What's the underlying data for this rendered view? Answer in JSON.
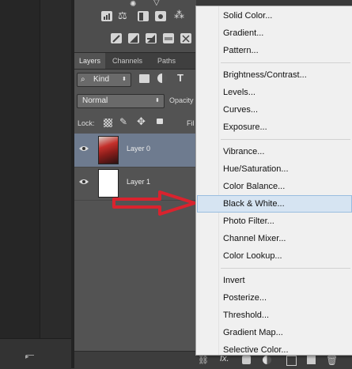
{
  "panel_tabs": [
    "Layers",
    "Channels",
    "Paths"
  ],
  "filter": {
    "kind_label": "Kind"
  },
  "blend": {
    "mode": "Normal",
    "opacity_label": "Opacity"
  },
  "lock": {
    "label": "Lock:",
    "fill_label": "Fil"
  },
  "layers": [
    {
      "name": "Layer 0",
      "selected": true
    },
    {
      "name": "Layer 1",
      "selected": false
    }
  ],
  "bottom_bar": {
    "fx_label": "fx."
  },
  "menu": {
    "groups": [
      [
        "Solid Color...",
        "Gradient...",
        "Pattern..."
      ],
      [
        "Brightness/Contrast...",
        "Levels...",
        "Curves...",
        "Exposure..."
      ],
      [
        "Vibrance...",
        "Hue/Saturation...",
        "Color Balance...",
        "Black & White...",
        "Photo Filter...",
        "Channel Mixer...",
        "Color Lookup..."
      ],
      [
        "Invert",
        "Posterize...",
        "Threshold...",
        "Gradient Map...",
        "Selective Color..."
      ]
    ],
    "highlighted": "Black & White..."
  },
  "colors": {
    "arrow": "#d9232e",
    "menu_highlight": "#d6e4f2",
    "selected_layer": "#6e7b8f"
  }
}
